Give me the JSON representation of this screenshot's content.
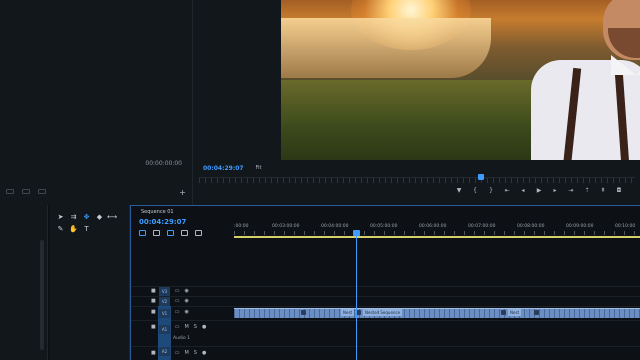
{
  "source_monitor": {
    "timecode": "00:00:00:00"
  },
  "program_monitor": {
    "timecode": "00:04:29:07",
    "zoom": "Fit",
    "controls": [
      "marker-icon",
      "in-icon",
      "out-icon",
      "go-to-in-icon",
      "step-back-icon",
      "play-icon",
      "step-forward-icon",
      "go-to-out-icon",
      "lift-icon",
      "extract-icon",
      "camera-icon"
    ]
  },
  "timeline": {
    "sequence_name": "Sequence 01",
    "timecode": "00:04:29:07",
    "ruler_labels": [
      ":00:00",
      "00:03:00:00",
      "00:04:00:00",
      "00:05:00:00",
      "00:06:00:00",
      "00:07:00:00",
      "00:08:00:00",
      "00:09:00:00",
      "00:10:00"
    ],
    "tracks": [
      {
        "name": "V3",
        "type": "video"
      },
      {
        "name": "V2",
        "type": "video"
      },
      {
        "name": "V1",
        "type": "video"
      },
      {
        "name": "A1",
        "type": "audio",
        "label": "Audio 1"
      },
      {
        "name": "A2",
        "type": "audio"
      }
    ],
    "clips": [
      "Nest",
      "Nested Sequence",
      "Nest"
    ]
  },
  "colors": {
    "accent": "#3e9bff",
    "work_area": "#d6cf6a",
    "clip": "#6b8fc4"
  }
}
